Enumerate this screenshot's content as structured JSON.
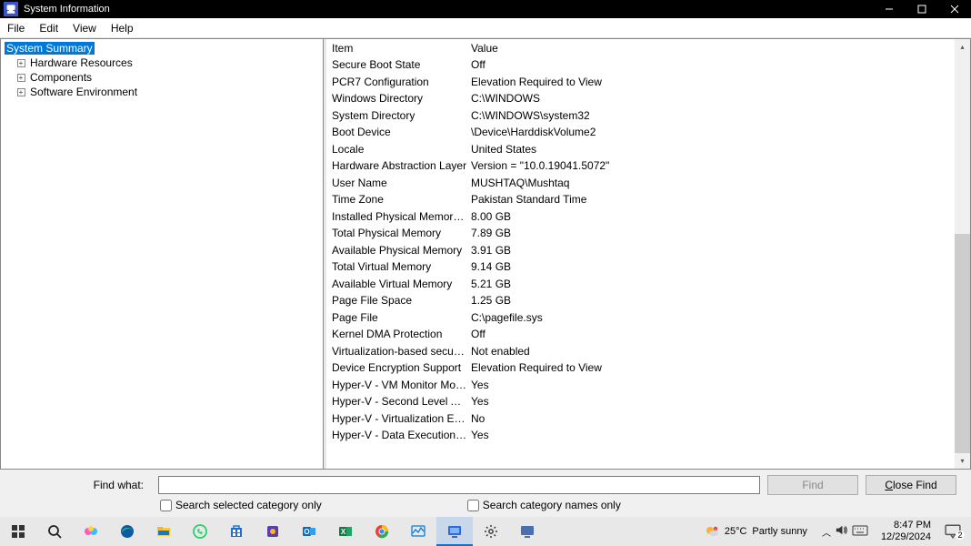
{
  "titlebar": {
    "title": "System Information"
  },
  "menu": {
    "file": "File",
    "edit": "Edit",
    "view": "View",
    "help": "Help"
  },
  "tree": {
    "root": "System Summary",
    "children": [
      {
        "label": "Hardware Resources"
      },
      {
        "label": "Components"
      },
      {
        "label": "Software Environment"
      }
    ]
  },
  "grid": {
    "header_item": "Item",
    "header_value": "Value",
    "rows": [
      {
        "item": "Secure Boot State",
        "value": "Off"
      },
      {
        "item": "PCR7 Configuration",
        "value": "Elevation Required to View"
      },
      {
        "item": "Windows Directory",
        "value": "C:\\WINDOWS"
      },
      {
        "item": "System Directory",
        "value": "C:\\WINDOWS\\system32"
      },
      {
        "item": "Boot Device",
        "value": "\\Device\\HarddiskVolume2"
      },
      {
        "item": "Locale",
        "value": "United States"
      },
      {
        "item": "Hardware Abstraction Layer",
        "value": "Version = \"10.0.19041.5072\""
      },
      {
        "item": "User Name",
        "value": "MUSHTAQ\\Mushtaq"
      },
      {
        "item": "Time Zone",
        "value": "Pakistan Standard Time"
      },
      {
        "item": "Installed Physical Memory (...",
        "value": "8.00 GB"
      },
      {
        "item": "Total Physical Memory",
        "value": "7.89 GB"
      },
      {
        "item": "Available Physical Memory",
        "value": "3.91 GB"
      },
      {
        "item": "Total Virtual Memory",
        "value": "9.14 GB"
      },
      {
        "item": "Available Virtual Memory",
        "value": "5.21 GB"
      },
      {
        "item": "Page File Space",
        "value": "1.25 GB"
      },
      {
        "item": "Page File",
        "value": "C:\\pagefile.sys"
      },
      {
        "item": "Kernel DMA Protection",
        "value": "Off"
      },
      {
        "item": "Virtualization-based security",
        "value": "Not enabled"
      },
      {
        "item": "Device Encryption Support",
        "value": "Elevation Required to View"
      },
      {
        "item": "Hyper-V - VM Monitor Mod...",
        "value": "Yes"
      },
      {
        "item": "Hyper-V - Second Level Ad...",
        "value": "Yes"
      },
      {
        "item": "Hyper-V - Virtualization En...",
        "value": "No"
      },
      {
        "item": "Hyper-V - Data Execution P...",
        "value": "Yes"
      }
    ]
  },
  "findbar": {
    "label": "Find what:",
    "find_button": "Find",
    "close_button": "Close Find",
    "search_selected": "Search selected category only",
    "search_names": "Search category names only"
  },
  "taskbar": {
    "weather_temp": "25°C",
    "weather_desc": "Partly sunny",
    "time": "8:47 PM",
    "date": "12/29/2024",
    "notif_count": "2"
  }
}
